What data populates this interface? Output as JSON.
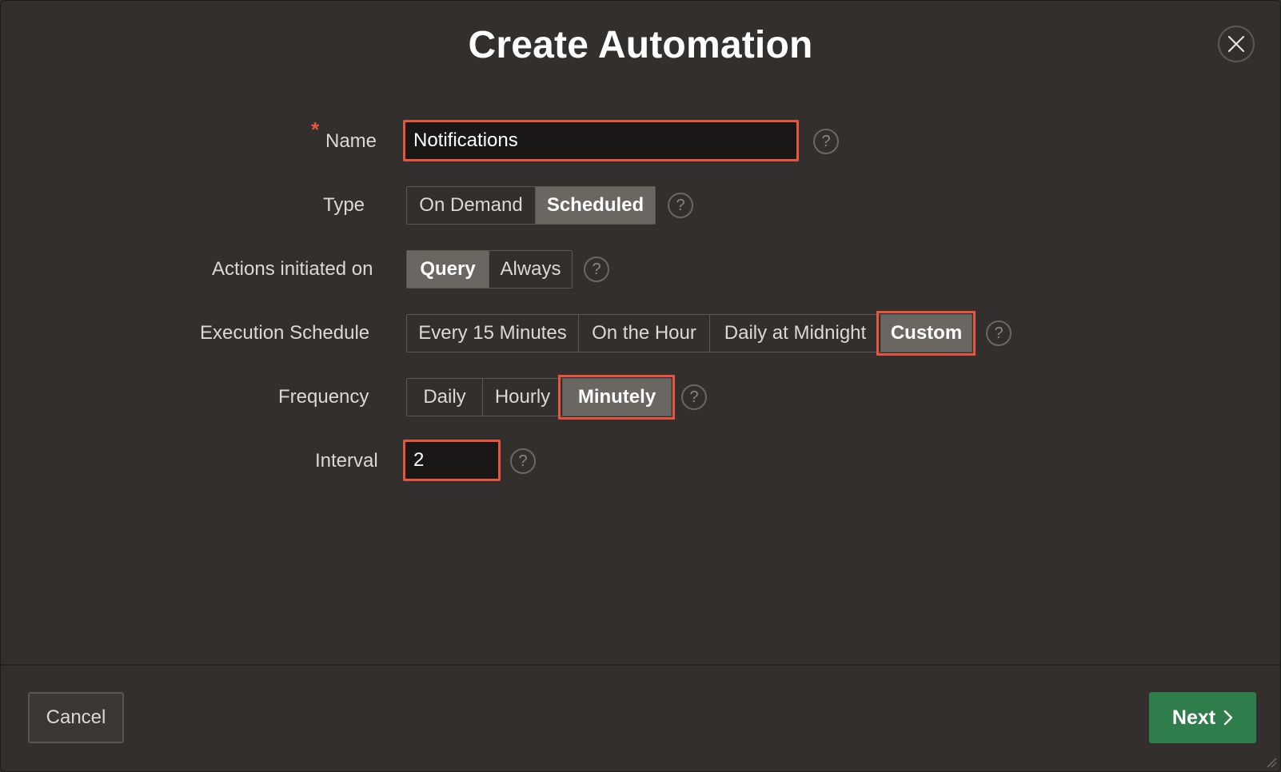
{
  "dialog": {
    "title": "Create Automation",
    "close_icon": "close-icon"
  },
  "form": {
    "name": {
      "required_mark": "*",
      "label": "Name",
      "value": "Notifications"
    },
    "type": {
      "label": "Type",
      "options": [
        "On Demand",
        "Scheduled"
      ],
      "selected": "Scheduled"
    },
    "actions": {
      "label": "Actions initiated on",
      "options": [
        "Query",
        "Always"
      ],
      "selected": "Query"
    },
    "schedule": {
      "label": "Execution Schedule",
      "options": [
        "Every 15 Minutes",
        "On the Hour",
        "Daily at Midnight",
        "Custom"
      ],
      "selected": "Custom"
    },
    "frequency": {
      "label": "Frequency",
      "options": [
        "Daily",
        "Hourly",
        "Minutely"
      ],
      "selected": "Minutely"
    },
    "interval": {
      "label": "Interval",
      "value": "2"
    },
    "help_glyph": "?"
  },
  "footer": {
    "cancel_label": "Cancel",
    "next_label": "Next",
    "next_icon": "chevron-right-icon"
  },
  "colors": {
    "background": "#322f2c",
    "highlight": "#e5553f",
    "selected_segment": "#6a6662",
    "primary_button": "#2f7d4a"
  }
}
